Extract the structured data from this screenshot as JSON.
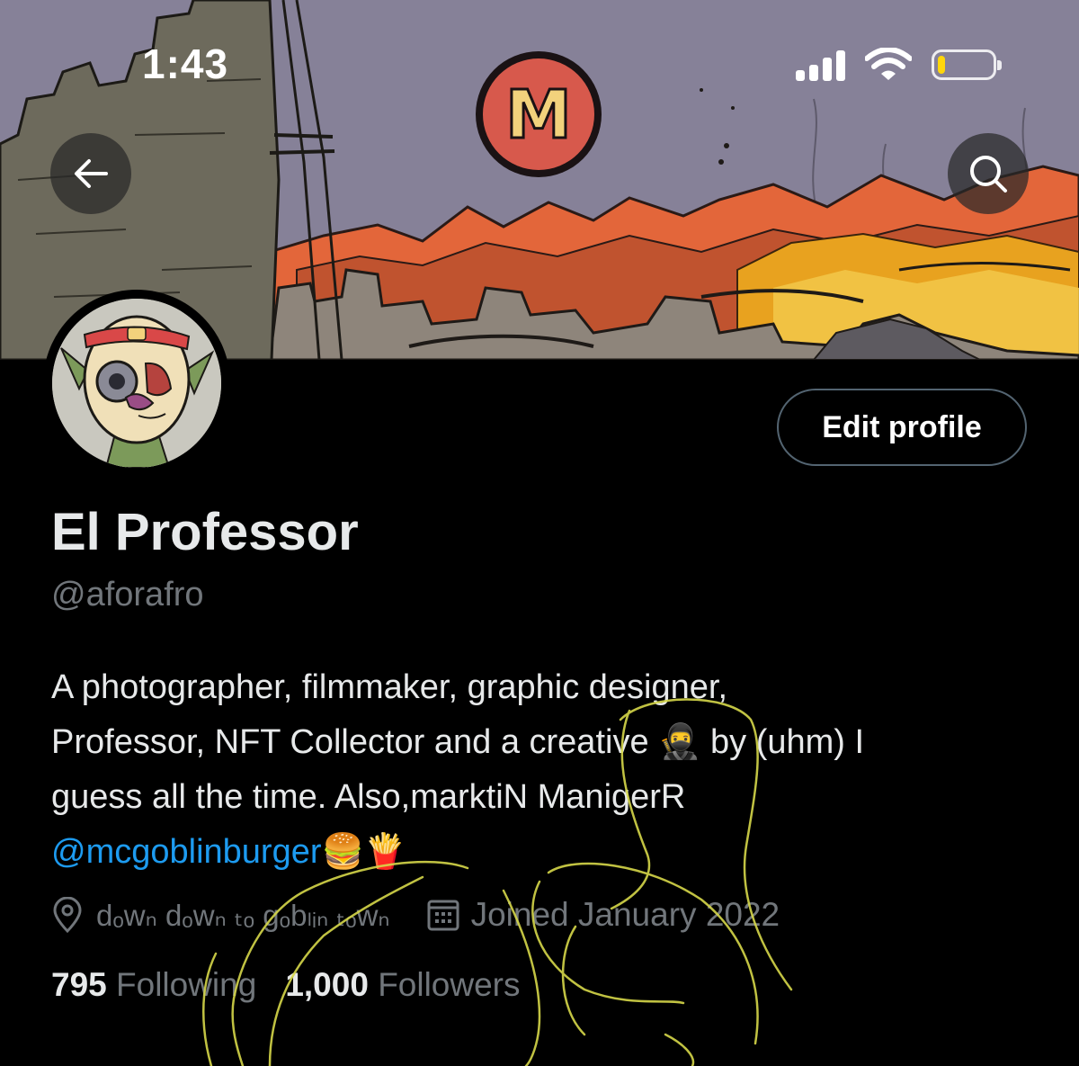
{
  "status_bar": {
    "time": "1:43",
    "battery_level": 0.12,
    "battery_color": "#ffd60a"
  },
  "header": {
    "back_icon": "arrow-left-icon",
    "search_icon": "search-icon",
    "banner_logo_letter": "M"
  },
  "profile": {
    "display_name": "El Professor",
    "handle": "@aforafro",
    "edit_button_label": "Edit profile",
    "bio_line1": "A photographer, filmmaker, graphic designer,",
    "bio_line2": "Professor, NFT Collector and a creative 🥷 by (uhm) I",
    "bio_line3": "guess all the time. Also,marktiN ManigerR",
    "bio_mention": "@mcgoblinburger",
    "bio_emojis": "🍔🍟",
    "location": "dₒwₙ dₒwₙ ₜₒ gₒbₗᵢₙ ₜₒwₙ",
    "joined": "Joined January 2022",
    "following_count": "795",
    "following_label": "Following",
    "followers_count": "1,000",
    "followers_label": "Followers"
  },
  "colors": {
    "background": "#000000",
    "text_primary": "#e7e9ea",
    "text_secondary": "#71767b",
    "link": "#1d9bf0",
    "scribble": "#d6d84a"
  }
}
